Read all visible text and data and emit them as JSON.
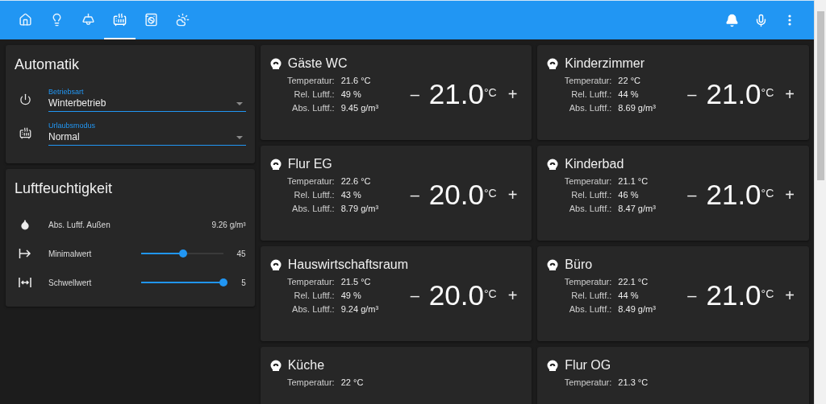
{
  "toolbar": {
    "tabs": [
      {
        "kind": "home",
        "selected": false
      },
      {
        "kind": "bulb",
        "selected": false
      },
      {
        "kind": "lamp",
        "selected": false
      },
      {
        "kind": "radiator",
        "selected": true
      },
      {
        "kind": "washer",
        "selected": false
      },
      {
        "kind": "weather",
        "selected": false
      }
    ],
    "actions": [
      {
        "kind": "bell"
      },
      {
        "kind": "mic"
      },
      {
        "kind": "menu"
      }
    ]
  },
  "automatik": {
    "title": "Automatik",
    "selects": [
      {
        "kind": "power",
        "label": "Betriebsart",
        "value": "Winterbetrieb"
      },
      {
        "kind": "radiator",
        "label": "Urlaubsmodus",
        "value": "Normal"
      }
    ]
  },
  "humidity": {
    "title": "Luftfeuchtigkeit",
    "rows": [
      {
        "kind": "sensor",
        "label": "Abs. Luftf. Außen",
        "value": "9.26 g/m³"
      },
      {
        "kind": "slider",
        "label": "Minimalwert",
        "level": 0.51,
        "value": "45"
      },
      {
        "kind": "slider",
        "label": "Schwellwert",
        "level": 1.0,
        "value": "5"
      }
    ]
  },
  "rooms": [
    {
      "name": "Gäste WC",
      "rows": [
        {
          "label": "Temperatur:",
          "value": "21.6 °C"
        },
        {
          "label": "Rel. Luftf.:",
          "value": "49 %"
        },
        {
          "label": "Abs. Luftf.:",
          "value": "9.45 g/m³"
        }
      ],
      "setpoint": {
        "minus": "–",
        "value": "21.0",
        "unit": "°C",
        "plus": "+"
      }
    },
    {
      "name": "Kinderzimmer",
      "rows": [
        {
          "label": "Temperatur:",
          "value": "22 °C"
        },
        {
          "label": "Rel. Luftf.:",
          "value": "44 %"
        },
        {
          "label": "Abs. Luftf.:",
          "value": "8.69 g/m³"
        }
      ],
      "setpoint": {
        "minus": "–",
        "value": "21.0",
        "unit": "°C",
        "plus": "+"
      }
    },
    {
      "name": "Flur EG",
      "rows": [
        {
          "label": "Temperatur:",
          "value": "22.6 °C"
        },
        {
          "label": "Rel. Luftf.:",
          "value": "43 %"
        },
        {
          "label": "Abs. Luftf.:",
          "value": "8.79 g/m³"
        }
      ],
      "setpoint": {
        "minus": "–",
        "value": "20.0",
        "unit": "°C",
        "plus": "+"
      }
    },
    {
      "name": "Kinderbad",
      "rows": [
        {
          "label": "Temperatur:",
          "value": "21.1 °C"
        },
        {
          "label": "Rel. Luftf.:",
          "value": "46 %"
        },
        {
          "label": "Abs. Luftf.:",
          "value": "8.47 g/m³"
        }
      ],
      "setpoint": {
        "minus": "–",
        "value": "21.0",
        "unit": "°C",
        "plus": "+"
      }
    },
    {
      "name": "Hauswirtschaftsraum",
      "rows": [
        {
          "label": "Temperatur:",
          "value": "21.5 °C"
        },
        {
          "label": "Rel. Luftf.:",
          "value": "49 %"
        },
        {
          "label": "Abs. Luftf.:",
          "value": "9.24 g/m³"
        }
      ],
      "setpoint": {
        "minus": "–",
        "value": "20.0",
        "unit": "°C",
        "plus": "+"
      }
    },
    {
      "name": "Büro",
      "rows": [
        {
          "label": "Temperatur:",
          "value": "22.1 °C"
        },
        {
          "label": "Rel. Luftf.:",
          "value": "44 %"
        },
        {
          "label": "Abs. Luftf.:",
          "value": "8.49 g/m³"
        }
      ],
      "setpoint": {
        "minus": "–",
        "value": "21.0",
        "unit": "°C",
        "plus": "+"
      }
    },
    {
      "name": "Küche",
      "rows": [
        {
          "label": "Temperatur:",
          "value": "22 °C"
        }
      ]
    },
    {
      "name": "Flur OG",
      "rows": [
        {
          "label": "Temperatur:",
          "value": "21.3 °C"
        }
      ]
    }
  ]
}
